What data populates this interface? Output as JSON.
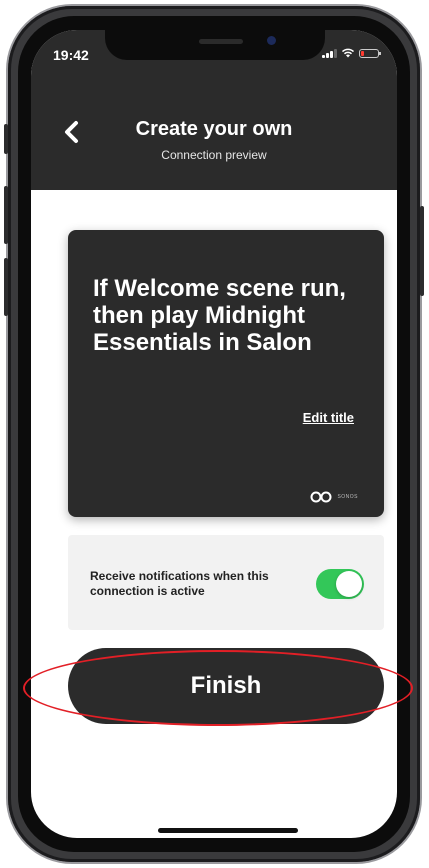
{
  "status_bar": {
    "time": "19:42",
    "signal": "signal-icon",
    "wifi": "wifi-icon",
    "battery": "battery-icon",
    "battery_level": 0.15
  },
  "header": {
    "back_icon": "chevron-left-icon",
    "title": "Create your own",
    "subtitle": "Connection preview"
  },
  "preview_card": {
    "title": "If Welcome scene run, then play Midnight Essentials in Salon",
    "edit_label": "Edit title",
    "brand_icon": "sonos-logo-icon",
    "brand_name": "SONOS"
  },
  "notifications": {
    "label": "Receive notifications when this connection is active",
    "enabled": true
  },
  "finish_button": {
    "label": "Finish"
  },
  "colors": {
    "header_bg": "#2b2b2b",
    "card_bg": "#2b2b2b",
    "toggle_on": "#33c759",
    "panel_bg": "#f2f2f2",
    "annotation": "#e21f26"
  }
}
